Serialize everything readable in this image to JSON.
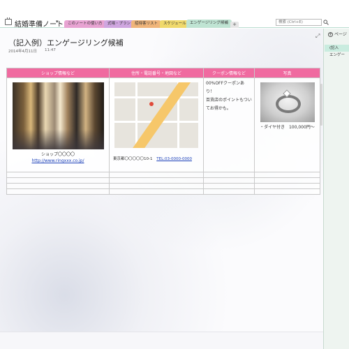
{
  "notebook": {
    "title": "結婚準備ノート",
    "dropdown_glyph": "▾"
  },
  "tabs": [
    {
      "label": "このノートの使い方",
      "color": "#e8a3d2"
    },
    {
      "label": "式場・プラン",
      "color": "#cfa6e0"
    },
    {
      "label": "招待客リスト",
      "color": "#f0b57a"
    },
    {
      "label": "スケジュール",
      "color": "#f0d96b"
    },
    {
      "label": "エンゲージリング候補",
      "color": "#bfe4d3",
      "active": true
    }
  ],
  "tab_add_label": "+",
  "search": {
    "placeholder": "検索 (Ctrl+E)"
  },
  "page": {
    "title": "（記入例）エンゲージリング候補",
    "date": "2014年4月11日",
    "time": "11:47"
  },
  "table": {
    "headers": [
      "ショップ情報など",
      "住所・電話番号・地図など",
      "クーポン情報など",
      "写真"
    ],
    "shop_caption": "ショップ〇〇〇〇",
    "shop_link": "http://www.ringxxx.co.jp/",
    "address": "東京都〇〇〇〇〇10-1",
    "tel": "TEL:03-0000-0000",
    "coupon_lines": [
      "00%OFFクーポンあり！",
      "百貨店のポイントもつい",
      "てお得かも。"
    ],
    "photo_caption": "・ダイヤ付き　100,000円〜"
  },
  "right_panel": {
    "add_page_label": "ページ",
    "pages": [
      "(記入",
      "エンゲー"
    ]
  },
  "icons": {
    "expand": "⤢",
    "search": "search-icon"
  },
  "colors": {
    "header_pink": "#f06aa0",
    "link_blue": "#1a3fb8",
    "panel_green": "#eef4f0"
  }
}
